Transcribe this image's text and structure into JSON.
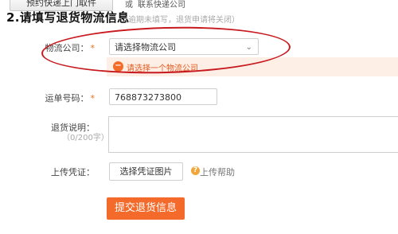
{
  "top": {
    "pickup_button": "预约快递上门取件",
    "or_text": "或",
    "contact_link": "联系快递公司"
  },
  "section": {
    "title": "2.请填写退货物流信息",
    "note": "（逾期未填写，退货申请将关闭）"
  },
  "form": {
    "logistics_label": "物流公司：",
    "logistics_value": "请选择物流公司",
    "logistics_error": "请选择一个物流公司",
    "tracking_label": "运单号码：",
    "tracking_value": "768873273800",
    "return_note_label": "退货说明：",
    "return_note_limit": "（0/200字）",
    "voucher_label": "上传凭证：",
    "voucher_button": "选择凭证图片",
    "upload_help": "上传帮助",
    "submit": "提交退货信息",
    "required_mark": "*"
  },
  "colors": {
    "accent": "#f36a2a",
    "error_bg": "#fdeee6",
    "annotation_red": "#c8191e"
  },
  "icons": {
    "chevron": "chevron-down-icon",
    "error": "error-icon",
    "help": "help-icon"
  }
}
